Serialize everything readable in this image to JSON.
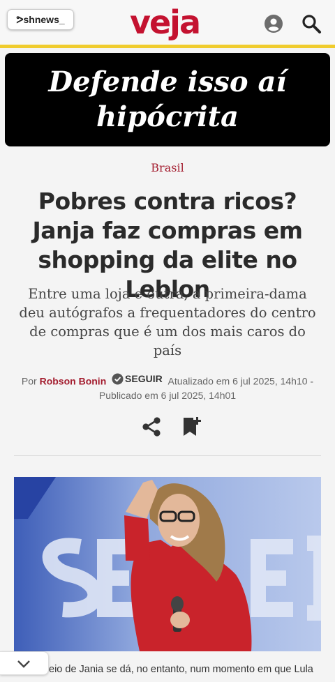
{
  "header": {
    "pushnews_label": "ᕗshnews_",
    "logo_text": "veja",
    "accent": "#c41230",
    "bar_color": "#f0cc2e"
  },
  "banner": {
    "line1": "Defende isso aí",
    "line2": "hipócrita"
  },
  "article": {
    "category": "Brasil",
    "title": "Pobres contra ricos? Janja faz compras em shopping da elite no Leblon",
    "subtitle": "Entre uma loja e outra, a primeira-dama deu autógrafos a frequentadores do centro de compras que é um dos mais caros do país",
    "byline_prefix": "Por",
    "author": "Robson Bonin",
    "follow_label": "SEGUIR",
    "updated": "Atualizado em 6 jul 2025, 14h10 -",
    "published": "Publicado em 6 jul 2025, 14h01",
    "caption_text": "eio de Jania se dá, no entanto, num momento em que Lula"
  },
  "icons": {
    "user": "user-icon",
    "search": "search-icon",
    "share": "share-icon",
    "bookmark": "bookmark-add-icon",
    "collapse": "chevron-down-icon"
  }
}
